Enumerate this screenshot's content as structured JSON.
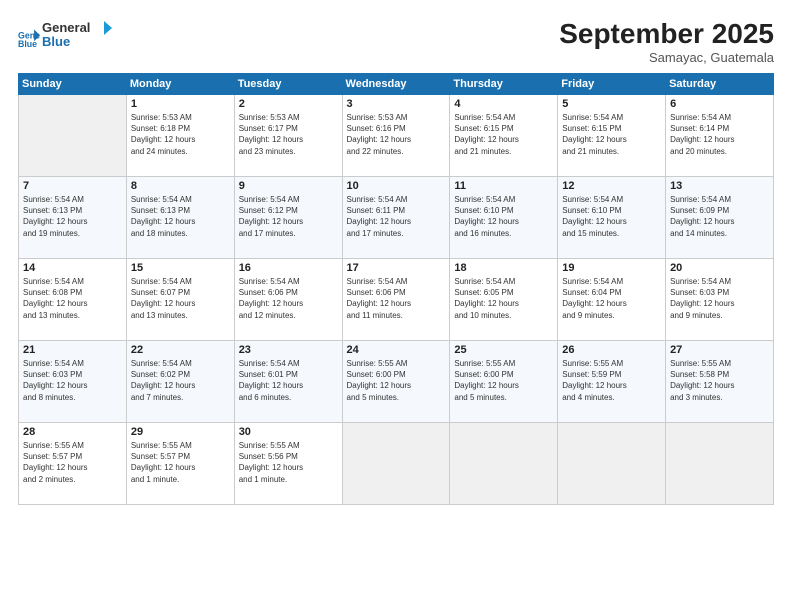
{
  "header": {
    "logo_line1": "General",
    "logo_line2": "Blue",
    "title": "September 2025",
    "subtitle": "Samayac, Guatemala"
  },
  "weekdays": [
    "Sunday",
    "Monday",
    "Tuesday",
    "Wednesday",
    "Thursday",
    "Friday",
    "Saturday"
  ],
  "weeks": [
    [
      {
        "num": "",
        "info": ""
      },
      {
        "num": "1",
        "info": "Sunrise: 5:53 AM\nSunset: 6:18 PM\nDaylight: 12 hours\nand 24 minutes."
      },
      {
        "num": "2",
        "info": "Sunrise: 5:53 AM\nSunset: 6:17 PM\nDaylight: 12 hours\nand 23 minutes."
      },
      {
        "num": "3",
        "info": "Sunrise: 5:53 AM\nSunset: 6:16 PM\nDaylight: 12 hours\nand 22 minutes."
      },
      {
        "num": "4",
        "info": "Sunrise: 5:54 AM\nSunset: 6:15 PM\nDaylight: 12 hours\nand 21 minutes."
      },
      {
        "num": "5",
        "info": "Sunrise: 5:54 AM\nSunset: 6:15 PM\nDaylight: 12 hours\nand 21 minutes."
      },
      {
        "num": "6",
        "info": "Sunrise: 5:54 AM\nSunset: 6:14 PM\nDaylight: 12 hours\nand 20 minutes."
      }
    ],
    [
      {
        "num": "7",
        "info": "Sunrise: 5:54 AM\nSunset: 6:13 PM\nDaylight: 12 hours\nand 19 minutes."
      },
      {
        "num": "8",
        "info": "Sunrise: 5:54 AM\nSunset: 6:13 PM\nDaylight: 12 hours\nand 18 minutes."
      },
      {
        "num": "9",
        "info": "Sunrise: 5:54 AM\nSunset: 6:12 PM\nDaylight: 12 hours\nand 17 minutes."
      },
      {
        "num": "10",
        "info": "Sunrise: 5:54 AM\nSunset: 6:11 PM\nDaylight: 12 hours\nand 17 minutes."
      },
      {
        "num": "11",
        "info": "Sunrise: 5:54 AM\nSunset: 6:10 PM\nDaylight: 12 hours\nand 16 minutes."
      },
      {
        "num": "12",
        "info": "Sunrise: 5:54 AM\nSunset: 6:10 PM\nDaylight: 12 hours\nand 15 minutes."
      },
      {
        "num": "13",
        "info": "Sunrise: 5:54 AM\nSunset: 6:09 PM\nDaylight: 12 hours\nand 14 minutes."
      }
    ],
    [
      {
        "num": "14",
        "info": "Sunrise: 5:54 AM\nSunset: 6:08 PM\nDaylight: 12 hours\nand 13 minutes."
      },
      {
        "num": "15",
        "info": "Sunrise: 5:54 AM\nSunset: 6:07 PM\nDaylight: 12 hours\nand 13 minutes."
      },
      {
        "num": "16",
        "info": "Sunrise: 5:54 AM\nSunset: 6:06 PM\nDaylight: 12 hours\nand 12 minutes."
      },
      {
        "num": "17",
        "info": "Sunrise: 5:54 AM\nSunset: 6:06 PM\nDaylight: 12 hours\nand 11 minutes."
      },
      {
        "num": "18",
        "info": "Sunrise: 5:54 AM\nSunset: 6:05 PM\nDaylight: 12 hours\nand 10 minutes."
      },
      {
        "num": "19",
        "info": "Sunrise: 5:54 AM\nSunset: 6:04 PM\nDaylight: 12 hours\nand 9 minutes."
      },
      {
        "num": "20",
        "info": "Sunrise: 5:54 AM\nSunset: 6:03 PM\nDaylight: 12 hours\nand 9 minutes."
      }
    ],
    [
      {
        "num": "21",
        "info": "Sunrise: 5:54 AM\nSunset: 6:03 PM\nDaylight: 12 hours\nand 8 minutes."
      },
      {
        "num": "22",
        "info": "Sunrise: 5:54 AM\nSunset: 6:02 PM\nDaylight: 12 hours\nand 7 minutes."
      },
      {
        "num": "23",
        "info": "Sunrise: 5:54 AM\nSunset: 6:01 PM\nDaylight: 12 hours\nand 6 minutes."
      },
      {
        "num": "24",
        "info": "Sunrise: 5:55 AM\nSunset: 6:00 PM\nDaylight: 12 hours\nand 5 minutes."
      },
      {
        "num": "25",
        "info": "Sunrise: 5:55 AM\nSunset: 6:00 PM\nDaylight: 12 hours\nand 5 minutes."
      },
      {
        "num": "26",
        "info": "Sunrise: 5:55 AM\nSunset: 5:59 PM\nDaylight: 12 hours\nand 4 minutes."
      },
      {
        "num": "27",
        "info": "Sunrise: 5:55 AM\nSunset: 5:58 PM\nDaylight: 12 hours\nand 3 minutes."
      }
    ],
    [
      {
        "num": "28",
        "info": "Sunrise: 5:55 AM\nSunset: 5:57 PM\nDaylight: 12 hours\nand 2 minutes."
      },
      {
        "num": "29",
        "info": "Sunrise: 5:55 AM\nSunset: 5:57 PM\nDaylight: 12 hours\nand 1 minute."
      },
      {
        "num": "30",
        "info": "Sunrise: 5:55 AM\nSunset: 5:56 PM\nDaylight: 12 hours\nand 1 minute."
      },
      {
        "num": "",
        "info": ""
      },
      {
        "num": "",
        "info": ""
      },
      {
        "num": "",
        "info": ""
      },
      {
        "num": "",
        "info": ""
      }
    ]
  ]
}
